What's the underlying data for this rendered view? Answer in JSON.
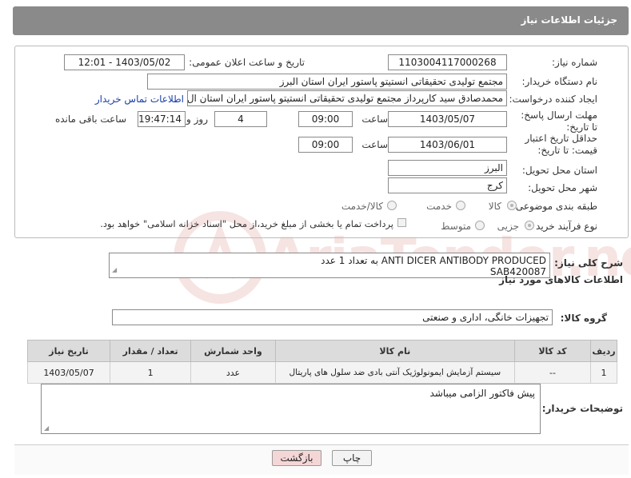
{
  "header": {
    "title": "جزئیات اطلاعات نیاز"
  },
  "watermark": {
    "text": "AriaTender.net"
  },
  "form": {
    "need_number_label": "شماره نیاز:",
    "need_number": "1103004117000268",
    "announce_label": "تاریخ و ساعت اعلان عمومی:",
    "announce_value": "1403/05/02 - 12:01",
    "buyer_org_label": "نام دستگاه خریدار:",
    "buyer_org": "مجتمع تولیدی تحقیقاتی انستیتو پاستور ایران استان البرز",
    "creator_label": "ایجاد کننده درخواست:",
    "creator": "محمدصادق سید کارپرداز مجتمع تولیدی تحقیقاتی انستیتو پاستور ایران استان ال",
    "contact_link": "اطلاعات تماس خریدار",
    "reply_deadline_label": "مهلت ارسال پاسخ: تا تاریخ:",
    "reply_date": "1403/05/07",
    "time_label": "ساعت",
    "reply_time": "09:00",
    "days_value": "4",
    "day_label": "روز و",
    "remaining_time": "19:47:14",
    "remaining_label": "ساعت باقی مانده",
    "price_validity_label": "حداقل تاریخ اعتبار قیمت: تا تاریخ:",
    "validity_date": "1403/06/01",
    "validity_time": "09:00",
    "province_label": "استان محل تحویل:",
    "province": "البرز",
    "city_label": "شهر محل تحویل:",
    "city": "کرج",
    "category_label": "طبقه بندی موضوعی:",
    "category_options": [
      "کالا",
      "خدمت",
      "کالا/خدمت"
    ],
    "process_label": "نوع فرآیند خرید :",
    "process_options": [
      "جزیی",
      "متوسط"
    ],
    "payment_note": "پرداخت تمام یا بخشی از مبلغ خرید،از محل \"اسناد خزانه اسلامی\" خواهد بود."
  },
  "description": {
    "label": "شرح کلی نیاز:",
    "line1": "ANTI DICER ANTIBODY PRODUCED به تعداد 1 عدد",
    "line2": "SAB420087"
  },
  "goods_section": {
    "title": "اطلاعات کالاهای مورد نیاز",
    "group_label": "گروه کالا:",
    "group_value": "تجهیزات خانگی، اداری و صنعتی"
  },
  "table": {
    "headers": [
      "ردیف",
      "کد کالا",
      "نام کالا",
      "واحد شمارش",
      "تعداد / مقدار",
      "تاریخ نیاز"
    ],
    "rows": [
      [
        "1",
        "--",
        "سیستم آزمایش ایمونولوژیک آنتی بادی ضد سلول های پاریتال",
        "عدد",
        "1",
        "1403/05/07"
      ]
    ]
  },
  "buyer_notes": {
    "label": "توضیحات خریدار:",
    "text": "پیش فاکتور الزامی میباشد"
  },
  "buttons": {
    "print": "چاپ",
    "back": "بازگشت"
  },
  "colors": {
    "header_bg": "#8a8a8a",
    "link": "#1a3fa8",
    "back_btn_bg": "#f5d6d6"
  }
}
